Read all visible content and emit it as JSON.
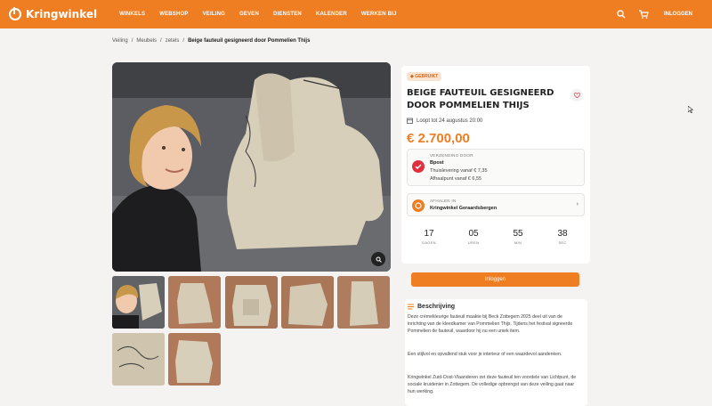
{
  "header": {
    "logo_text": "Kringwinkel",
    "nav": [
      "WINKELS",
      "WEBSHOP",
      "VEILING",
      "GEVEN",
      "DIENSTEN",
      "KALENDER",
      "WERKEN BIJ"
    ],
    "login_label": "INLOGGEN",
    "icons": [
      "search-icon",
      "cart-icon"
    ],
    "accent_color": "#ef7d22"
  },
  "breadcrumb": {
    "items": [
      "Veiling",
      "/",
      "Meubels",
      "/",
      "zetels",
      "/"
    ],
    "current": "Beige fauteuil gesigneerd door Pommelien Thijs"
  },
  "product": {
    "badge": "GEBRUIKT",
    "title": "BEIGE FAUTEUIL GESIGNEERD DOOR POMMELIEN THIJS",
    "date_line": "Loopt tot 24 augustus 20:00",
    "price": "€ 2.700,00",
    "shipping": {
      "label": "VERZENDING DOOR",
      "carrier": "Bpost",
      "line1": "Thuislevering vanaf € 7,35",
      "line2": "Afhaalpunt vanaf € 6,55"
    },
    "pickup": {
      "label": "AFHALEN IN",
      "store": "Kringwinkel Geraardsbergen"
    },
    "countdown": [
      {
        "value": "17",
        "unit": "DAGEN"
      },
      {
        "value": "05",
        "unit": "UREN"
      },
      {
        "value": "55",
        "unit": "MIN"
      },
      {
        "value": "38",
        "unit": "SEC"
      }
    ],
    "bid_button": "Inloggen"
  },
  "description": {
    "heading": "Beschrijving",
    "paragraphs": [
      "Deze crèmekleurige fauteuil maakte bij Beck Zottegem 2025 deel uit van de inrichting van de kleedkamer van Pommelien Thijs. Tijdens het festival signeerde Pommelien de fauteuil, waardoor hij nu een uniek item.",
      "Een stijlvol en opvallend stuk voor je interieur of een waardevol aandenken.",
      "Kringwinkel Zuid-Oost-Vlaanderen zet deze fauteuil ten voordele van Lichtpunt, de sociale kruidenier in Zottegem. De volledige opbrengst van deze veiling gaat naar hun werking."
    ]
  }
}
